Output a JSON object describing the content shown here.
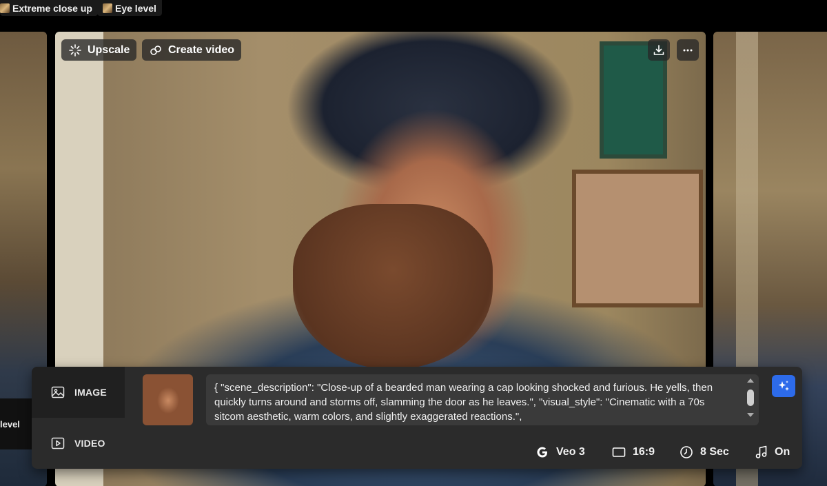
{
  "tags": [
    {
      "label": "Extreme close up"
    },
    {
      "label": "Eye level"
    }
  ],
  "side_label": "level",
  "card_actions": {
    "upscale_label": "Upscale",
    "create_video_label": "Create video"
  },
  "panel": {
    "modes": [
      {
        "label": "IMAGE",
        "icon": "image-icon",
        "selected": true
      },
      {
        "label": "VIDEO",
        "icon": "video-icon",
        "selected": false
      }
    ],
    "prompt": "{ \"scene_description\": \"Close-up of a bearded man wearing a cap looking shocked and furious. He yells, then quickly turns around and storms off, slamming the door as he leaves.\", \"visual_style\": \"Cinematic with a 70s sitcom aesthetic, warm colors, and slightly exaggerated reactions.\",",
    "settings": {
      "model": "Veo 3",
      "aspect_ratio": "16:9",
      "duration": "8 Sec",
      "audio": "On"
    },
    "accent_color": "#2d6bea"
  }
}
